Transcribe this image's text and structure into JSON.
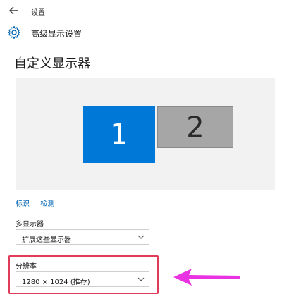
{
  "window": {
    "title": "设置"
  },
  "header": {
    "title": "高级显示设置"
  },
  "section": {
    "title": "自定义显示器"
  },
  "displays": {
    "monitor_1_label": "1",
    "monitor_2_label": "2"
  },
  "links": {
    "identify": "标识",
    "detect": "检测"
  },
  "multiple_displays": {
    "label": "多显示器",
    "value": "扩展这些显示器"
  },
  "resolution": {
    "label": "分辨率",
    "value": "1280 × 1024 (推荐)"
  },
  "colors": {
    "accent": "#0078d7",
    "link": "#0063b1",
    "highlight_box": "#e03c5a",
    "arrow": "#e933e3"
  },
  "icons": {
    "back": "back-arrow-icon",
    "settings": "gear-icon",
    "dropdown": "chevron-down-icon",
    "annotation": "left-arrow-icon"
  }
}
